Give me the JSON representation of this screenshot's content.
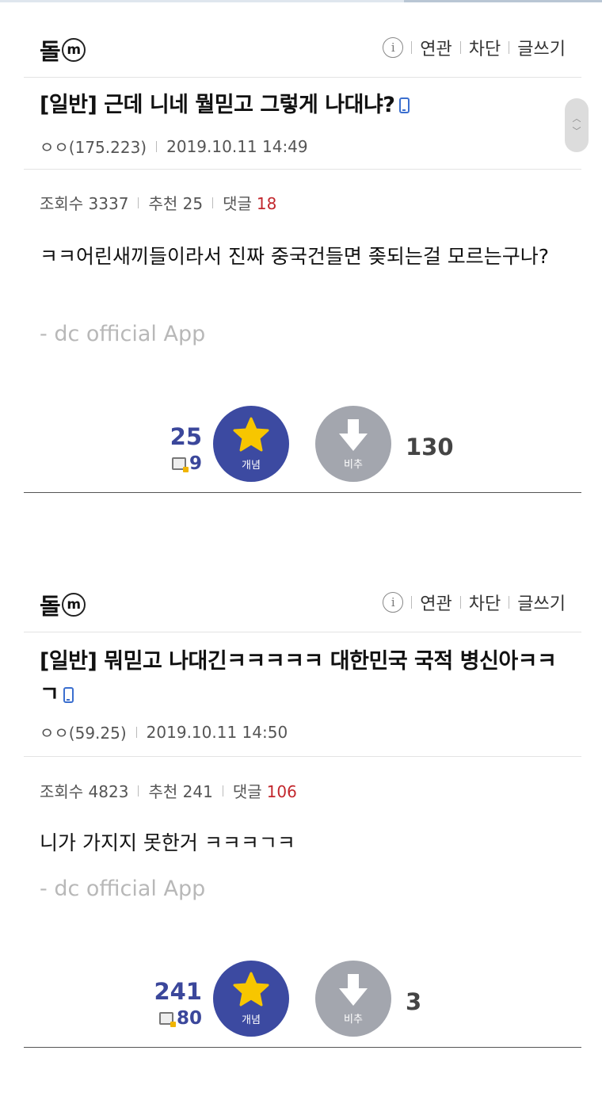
{
  "posts": [
    {
      "gallery_name": "돌",
      "gallery_badge": "m",
      "menu": {
        "related": "연관",
        "block": "차단",
        "write": "글쓰기"
      },
      "title": "[일반] 근데 니네 뭘믿고 그렇게 나대냐?",
      "author": "ㅇㅇ(175.223)",
      "datetime": "2019.10.11 14:49",
      "views_label": "조회수 3337",
      "recommend_label": "추천 25",
      "comments_label": "댓글",
      "comments_count": "18",
      "content": "ㅋㅋ어린새끼들이라서 진짜 중국건들면 좆되는걸 모르는구나?",
      "signature": "- dc official App",
      "upvotes": "25",
      "fixed_upvotes": "9",
      "up_label": "개념",
      "down_label": "비추",
      "downvotes": "130"
    },
    {
      "gallery_name": "돌",
      "gallery_badge": "m",
      "menu": {
        "related": "연관",
        "block": "차단",
        "write": "글쓰기"
      },
      "title": "[일반] 뭐믿고 나대긴ㅋㅋㅋㅋㅋ 대한민국 국적 병신아ㅋㅋㄱ",
      "author": "ㅇㅇ(59.25)",
      "datetime": "2019.10.11 14:50",
      "views_label": "조회수 4823",
      "recommend_label": "추천 241",
      "comments_label": "댓글",
      "comments_count": "106",
      "content": "니가 가지지 못한거 ㅋㅋㅋㄱㅋ",
      "signature": "- dc official App",
      "upvotes": "241",
      "fixed_upvotes": "80",
      "up_label": "개념",
      "down_label": "비추",
      "downvotes": "3"
    }
  ],
  "colors": {
    "accent": "#3c4aa1",
    "downvote": "#a3a6ae",
    "comment_count": "#c2272d",
    "signature": "#b8b8b8"
  }
}
